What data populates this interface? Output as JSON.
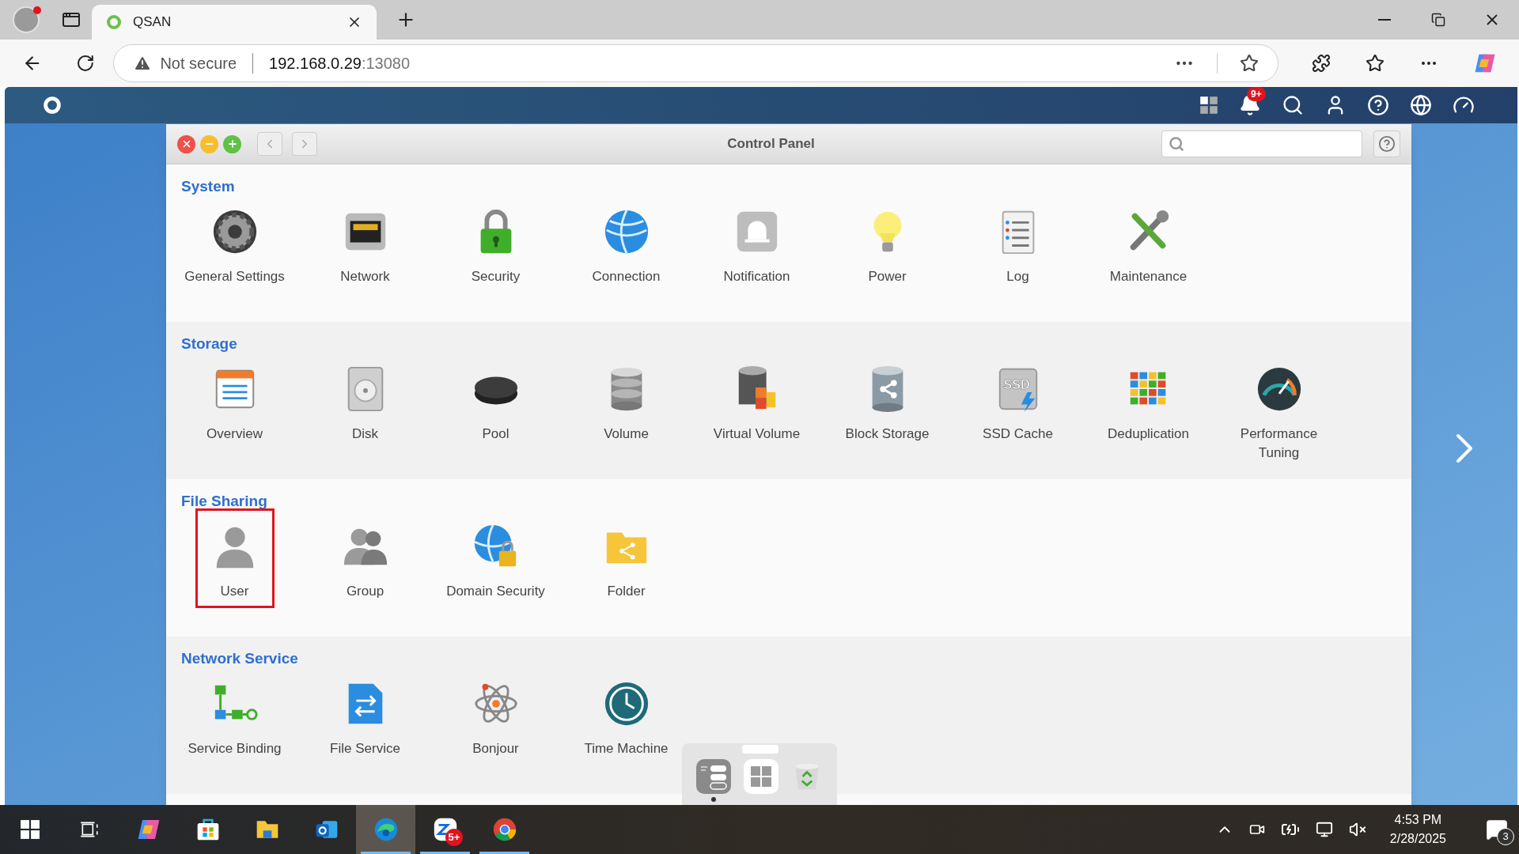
{
  "browser": {
    "tab": {
      "title": "QSAN"
    },
    "address": {
      "security": "Not secure",
      "host": "192.168.0.29",
      "port": ":13080"
    }
  },
  "app_header": {
    "notification_badge": "9+"
  },
  "window": {
    "title": "Control Panel"
  },
  "sections": [
    {
      "title": "System",
      "items": [
        {
          "label": "General Settings",
          "selected": false
        },
        {
          "label": "Network",
          "selected": false
        },
        {
          "label": "Security",
          "selected": false
        },
        {
          "label": "Connection",
          "selected": false
        },
        {
          "label": "Notification",
          "selected": false
        },
        {
          "label": "Power",
          "selected": false
        },
        {
          "label": "Log",
          "selected": false
        },
        {
          "label": "Maintenance",
          "selected": false
        }
      ]
    },
    {
      "title": "Storage",
      "items": [
        {
          "label": "Overview",
          "selected": false
        },
        {
          "label": "Disk",
          "selected": false
        },
        {
          "label": "Pool",
          "selected": false
        },
        {
          "label": "Volume",
          "selected": false
        },
        {
          "label": "Virtual Volume",
          "selected": false
        },
        {
          "label": "Block Storage",
          "selected": false
        },
        {
          "label": "SSD Cache",
          "selected": false,
          "icon_text": "SSD"
        },
        {
          "label": "Deduplication",
          "selected": false
        },
        {
          "label": "Performance Tuning",
          "selected": false
        }
      ]
    },
    {
      "title": "File Sharing",
      "items": [
        {
          "label": "User",
          "selected": true
        },
        {
          "label": "Group",
          "selected": false
        },
        {
          "label": "Domain Security",
          "selected": false
        },
        {
          "label": "Folder",
          "selected": false
        }
      ]
    },
    {
      "title": "Network Service",
      "items": [
        {
          "label": "Service Binding",
          "selected": false
        },
        {
          "label": "File Service",
          "selected": false
        },
        {
          "label": "Bonjour",
          "selected": false
        },
        {
          "label": "Time Machine",
          "selected": false
        }
      ]
    }
  ],
  "taskbar": {
    "apps": [
      {
        "selected": false,
        "running": false
      },
      {
        "selected": false,
        "running": false
      },
      {
        "selected": false,
        "running": false
      },
      {
        "selected": false,
        "running": false
      },
      {
        "selected": false,
        "running": false
      },
      {
        "selected": false,
        "running": false
      },
      {
        "selected": true,
        "running": true
      },
      {
        "selected": false,
        "running": true,
        "badge": "5+"
      },
      {
        "selected": false,
        "running": true
      }
    ],
    "clock": {
      "time": "4:53 PM",
      "date": "2/28/2025"
    },
    "notification_count": "3"
  }
}
